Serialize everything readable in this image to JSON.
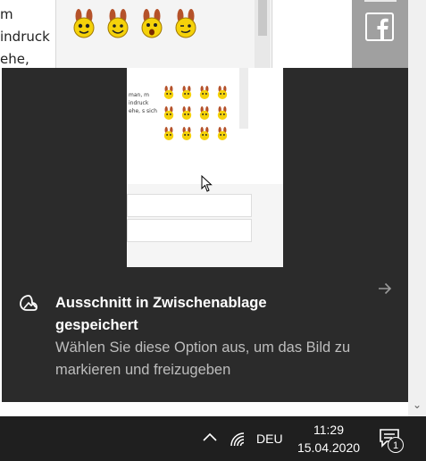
{
  "background": {
    "text_lines": [
      "m",
      "indruck",
      "ehe,"
    ]
  },
  "toast": {
    "title": "Ausschnitt in Zwischenablage gespeichert",
    "subtitle": "Wählen Sie diese Option aus, um das Bild zu markieren und freizugeben",
    "preview_text": "man, m indruck ehe, s sich"
  },
  "taskbar": {
    "language": "DEU",
    "time": "11:29",
    "date": "15.04.2020",
    "notification_count": "1"
  },
  "icons": {
    "facebook": "facebook-icon",
    "snip": "snip-sketch-icon",
    "arrow": "arrow-right-icon",
    "wifi": "wifi-icon",
    "chevron": "chevron-up-icon",
    "notify": "action-center-icon"
  },
  "colors": {
    "toast_bg": "#2b2b2b",
    "taskbar_bg": "#1f1f1f",
    "emoji_yellow": "#f5d20a",
    "emoji_ears": "#b5522a"
  }
}
